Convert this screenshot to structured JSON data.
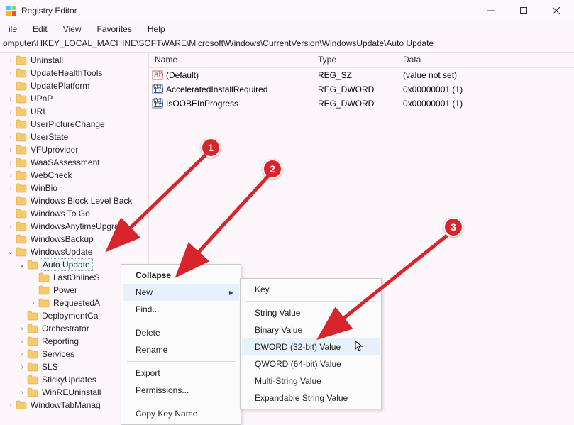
{
  "window": {
    "title": "Registry Editor",
    "buttons": {
      "min": "minimize",
      "max": "maximize",
      "close": "close"
    }
  },
  "menu": [
    "ile",
    "Edit",
    "View",
    "Favorites",
    "Help"
  ],
  "address": "omputer\\HKEY_LOCAL_MACHINE\\SOFTWARE\\Microsoft\\Windows\\CurrentVersion\\WindowsUpdate\\Auto Update",
  "tree": [
    {
      "lvl": 1,
      "exp": "closed",
      "label": "Uninstall"
    },
    {
      "lvl": 1,
      "exp": "closed",
      "label": "UpdateHealthTools"
    },
    {
      "lvl": 1,
      "exp": "none",
      "label": "UpdatePlatform"
    },
    {
      "lvl": 1,
      "exp": "closed",
      "label": "UPnP"
    },
    {
      "lvl": 1,
      "exp": "closed",
      "label": "URL"
    },
    {
      "lvl": 1,
      "exp": "closed",
      "label": "UserPictureChange"
    },
    {
      "lvl": 1,
      "exp": "closed",
      "label": "UserState"
    },
    {
      "lvl": 1,
      "exp": "closed",
      "label": "VFUprovider"
    },
    {
      "lvl": 1,
      "exp": "closed",
      "label": "WaaSAssessment"
    },
    {
      "lvl": 1,
      "exp": "closed",
      "label": "WebCheck"
    },
    {
      "lvl": 1,
      "exp": "closed",
      "label": "WinBio"
    },
    {
      "lvl": 1,
      "exp": "none",
      "label": "Windows Block Level Back"
    },
    {
      "lvl": 1,
      "exp": "none",
      "label": "Windows To Go"
    },
    {
      "lvl": 1,
      "exp": "closed",
      "label": "WindowsAnytimeUpgra"
    },
    {
      "lvl": 1,
      "exp": "none",
      "label": "WindowsBackup"
    },
    {
      "lvl": 1,
      "exp": "open",
      "label": "WindowsUpdate"
    },
    {
      "lvl": 2,
      "exp": "open",
      "label": "Auto Update",
      "selected": true
    },
    {
      "lvl": 3,
      "exp": "none",
      "label": "LastOnlineS"
    },
    {
      "lvl": 3,
      "exp": "none",
      "label": "Power"
    },
    {
      "lvl": 3,
      "exp": "closed",
      "label": "RequestedA"
    },
    {
      "lvl": 2,
      "exp": "none",
      "label": "DeploymentCa"
    },
    {
      "lvl": 2,
      "exp": "closed",
      "label": "Orchestrator"
    },
    {
      "lvl": 2,
      "exp": "closed",
      "label": "Reporting"
    },
    {
      "lvl": 2,
      "exp": "closed",
      "label": "Services"
    },
    {
      "lvl": 2,
      "exp": "closed",
      "label": "SLS"
    },
    {
      "lvl": 2,
      "exp": "none",
      "label": "StickyUpdates"
    },
    {
      "lvl": 2,
      "exp": "closed",
      "label": "WinREUninstall"
    },
    {
      "lvl": 1,
      "exp": "closed",
      "label": "WindowTabManag"
    }
  ],
  "list": {
    "headers": {
      "name": "Name",
      "type": "Type",
      "data": "Data"
    },
    "rows": [
      {
        "icon": "string",
        "name": "(Default)",
        "type": "REG_SZ",
        "data": "(value not set)"
      },
      {
        "icon": "binary",
        "name": "AcceleratedInstallRequired",
        "type": "REG_DWORD",
        "data": "0x00000001 (1)"
      },
      {
        "icon": "binary",
        "name": "IsOOBEInProgress",
        "type": "REG_DWORD",
        "data": "0x00000001 (1)"
      }
    ]
  },
  "context1": {
    "items": [
      {
        "label": "Collapse",
        "bold": true
      },
      {
        "label": "New",
        "sub": true,
        "hover": true
      },
      {
        "label": "Find..."
      },
      {
        "sep": true
      },
      {
        "label": "Delete"
      },
      {
        "label": "Rename"
      },
      {
        "sep": true
      },
      {
        "label": "Export"
      },
      {
        "label": "Permissions..."
      },
      {
        "sep": true
      },
      {
        "label": "Copy Key Name"
      }
    ]
  },
  "context2": {
    "items": [
      {
        "label": "Key"
      },
      {
        "sep": true
      },
      {
        "label": "String Value"
      },
      {
        "label": "Binary Value"
      },
      {
        "label": "DWORD (32-bit) Value",
        "hover": true
      },
      {
        "label": "QWORD (64-bit) Value"
      },
      {
        "label": "Multi-String Value"
      },
      {
        "label": "Expandable String Value"
      }
    ]
  },
  "callouts": {
    "c1": "1",
    "c2": "2",
    "c3": "3"
  }
}
